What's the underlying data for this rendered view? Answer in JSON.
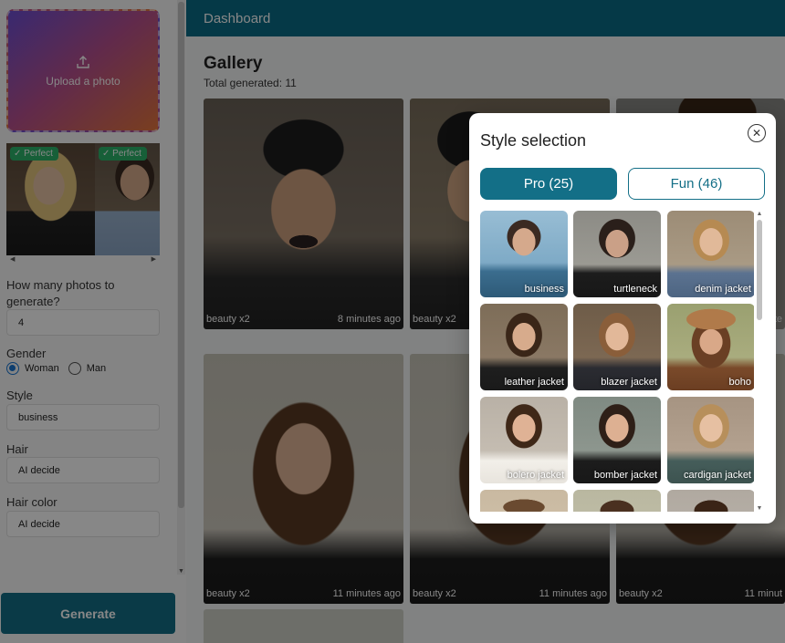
{
  "sidebar": {
    "upload_label": "Upload a photo",
    "reference_badges": [
      "Perfect",
      "Perfect"
    ],
    "count_label": "How many photos to generate?",
    "count_value": "4",
    "gender_label": "Gender",
    "gender_options": [
      "Woman",
      "Man"
    ],
    "gender_selected": "Woman",
    "style_label": "Style",
    "style_value": "business",
    "hair_label": "Hair",
    "hair_value": "AI decide",
    "hair_color_label": "Hair color",
    "hair_color_value": "AI decide",
    "generate_label": "Generate"
  },
  "header": {
    "title": "Dashboard"
  },
  "gallery": {
    "title": "Gallery",
    "total_label": "Total generated: 11",
    "cards": [
      {
        "tag": "beauty x2",
        "time": "8 minutes ago"
      },
      {
        "tag": "beauty x2",
        "time": ""
      },
      {
        "tag": "",
        "time": "ute"
      },
      {
        "tag": "beauty x2",
        "time": "11 minutes ago"
      },
      {
        "tag": "beauty x2",
        "time": "11 minutes ago"
      },
      {
        "tag": "beauty x2",
        "time": "11 minut"
      }
    ]
  },
  "modal": {
    "title": "Style selection",
    "close_icon": "close-circle-icon",
    "tabs": [
      {
        "label": "Pro (25)",
        "active": true
      },
      {
        "label": "Fun (46)",
        "active": false
      }
    ],
    "styles": [
      "business",
      "turtleneck",
      "denim jacket",
      "leather jacket",
      "blazer jacket",
      "boho",
      "bolero jacket",
      "bomber jacket",
      "cardigan jacket"
    ]
  },
  "colors": {
    "accent": "#136f87",
    "header": "#0b6d86",
    "badge": "#2db36a",
    "radio": "#1976d2"
  }
}
